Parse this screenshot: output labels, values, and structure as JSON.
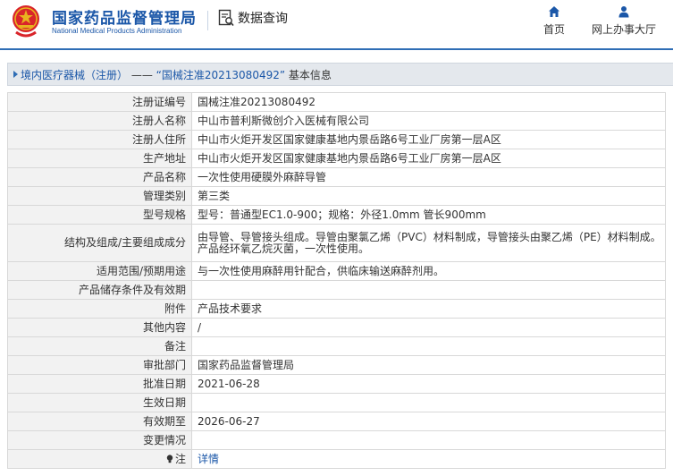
{
  "header": {
    "logo_cn": "国家药品监督管理局",
    "logo_en": "National Medical Products Administration",
    "query_label": "数据查询",
    "nav": [
      {
        "label": "首页",
        "icon": "home-icon"
      },
      {
        "label": "网上办事大厅",
        "icon": "user-icon"
      }
    ]
  },
  "breadcrumb": {
    "category": "境内医疗器械（注册）",
    "separator": " —— ",
    "record": "“国械注准20213080492”",
    "suffix": " 基本信息"
  },
  "rows": [
    {
      "label": "注册证编号",
      "value": "国械注准20213080492"
    },
    {
      "label": "注册人名称",
      "value": "中山市普利斯微创介入医械有限公司"
    },
    {
      "label": "注册人住所",
      "value": "中山市火炬开发区国家健康基地内景岳路6号工业厂房第一层A区"
    },
    {
      "label": "生产地址",
      "value": "中山市火炬开发区国家健康基地内景岳路6号工业厂房第一层A区"
    },
    {
      "label": "产品名称",
      "value": "一次性使用硬膜外麻醉导管"
    },
    {
      "label": "管理类别",
      "value": "第三类"
    },
    {
      "label": "型号规格",
      "value": "型号：普通型EC1.0-900；规格：外径1.0mm 管长900mm"
    },
    {
      "label": "结构及组成/主要组成成分",
      "value": "由导管、导管接头组成。导管由聚氯乙烯（PVC）材料制成，导管接头由聚乙烯（PE）材料制成。产品经环氧乙烷灭菌，一次性使用。"
    },
    {
      "label": "适用范围/预期用途",
      "value": "与一次性使用麻醉用针配合，供临床输送麻醉剂用。"
    },
    {
      "label": "产品储存条件及有效期",
      "value": ""
    },
    {
      "label": "附件",
      "value": "产品技术要求"
    },
    {
      "label": "其他内容",
      "value": "/"
    },
    {
      "label": "备注",
      "value": ""
    },
    {
      "label": "审批部门",
      "value": "国家药品监督管理局"
    },
    {
      "label": "批准日期",
      "value": "2021-06-28"
    },
    {
      "label": "生效日期",
      "value": ""
    },
    {
      "label": "有效期至",
      "value": "2026-06-27"
    },
    {
      "label": "变更情况",
      "value": ""
    },
    {
      "label": "注",
      "value": "详情"
    }
  ],
  "colors": {
    "brand_blue": "#1b57a8",
    "logo_red": "#d9242a",
    "logo_gold": "#e8b21f",
    "label_bg": "#f2f2f2",
    "crumb_bg": "#e4e8ed"
  }
}
